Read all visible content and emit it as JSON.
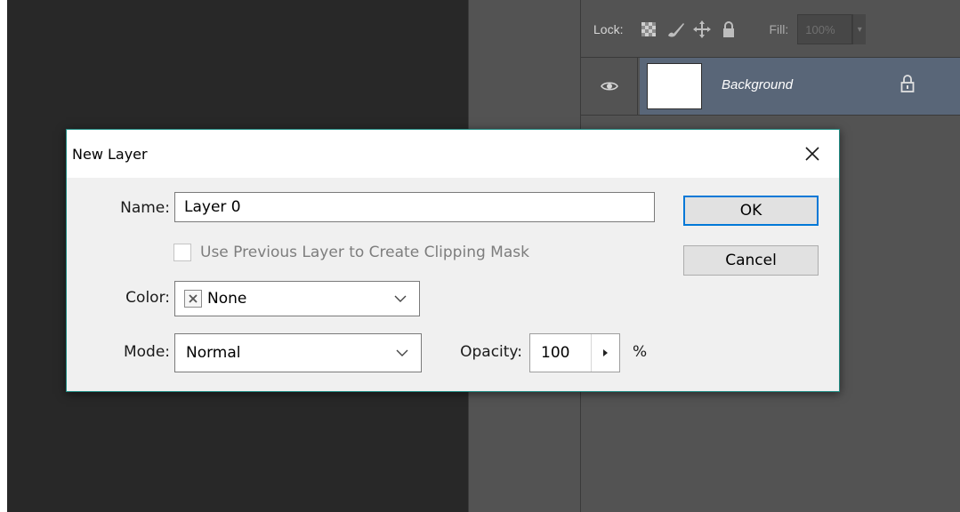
{
  "layers_panel": {
    "lock_label": "Lock:",
    "lock_icons": [
      "lock-transparent-pixels-icon",
      "lock-image-pixels-icon",
      "lock-position-icon",
      "lock-all-icon"
    ],
    "fill_label": "Fill:",
    "fill_value": "100%",
    "layer": {
      "name": "Background",
      "visible": true,
      "locked": true
    }
  },
  "dialog": {
    "title": "New Layer",
    "name_label": "Name:",
    "name_value": "Layer 0",
    "clipping_label": "Use Previous Layer to Create Clipping Mask",
    "clipping_checked": false,
    "color_label": "Color:",
    "color_value": "None",
    "mode_label": "Mode:",
    "mode_value": "Normal",
    "opacity_label": "Opacity:",
    "opacity_value": "100",
    "opacity_unit": "%",
    "ok_label": "OK",
    "cancel_label": "Cancel"
  },
  "colors": {
    "dialog_border": "#1f8a82",
    "ok_focus": "#0078d7",
    "selected_layer": "#596678",
    "panel_bg": "#535353",
    "canvas_bg": "#282828"
  }
}
